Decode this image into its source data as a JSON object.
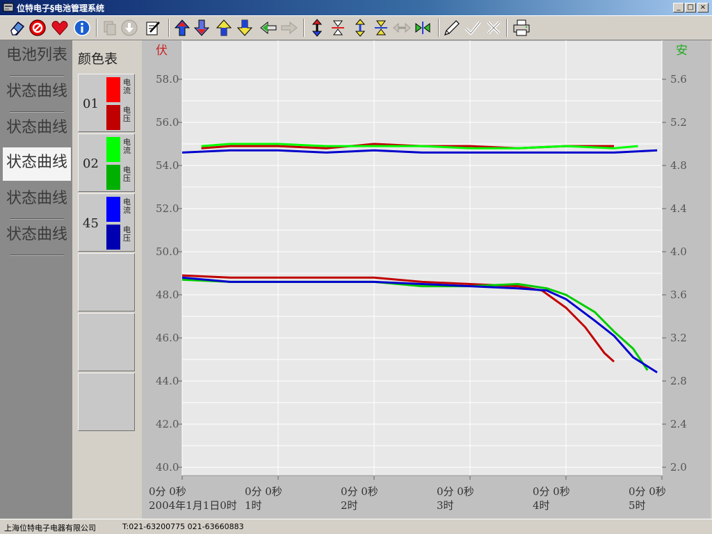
{
  "window": {
    "title": "位特电子§电池管理系统",
    "controls": [
      "_",
      "□",
      "×"
    ]
  },
  "toolbar": {
    "buttons": [
      {
        "icon": "eraser-icon",
        "enabled": true
      },
      {
        "icon": "no-entry-icon",
        "enabled": true
      },
      {
        "icon": "heart-icon",
        "enabled": true
      },
      {
        "icon": "info-icon",
        "enabled": true
      },
      {
        "icon": "copy-icon",
        "enabled": false
      },
      {
        "icon": "download-icon",
        "enabled": false
      },
      {
        "icon": "edit-document-icon",
        "enabled": true
      },
      {
        "icon": "arrow-up-icon",
        "enabled": true
      },
      {
        "icon": "arrow-down-icon",
        "enabled": true
      },
      {
        "icon": "arrow-up-yellow-icon",
        "enabled": true
      },
      {
        "icon": "arrow-down-yellow-icon",
        "enabled": true
      },
      {
        "icon": "arrow-left-icon",
        "enabled": true
      },
      {
        "icon": "arrow-right-icon",
        "enabled": false
      },
      {
        "icon": "expand-vertical-icon",
        "enabled": true
      },
      {
        "icon": "compress-vertical-icon",
        "enabled": true
      },
      {
        "icon": "expand-vertical-yellow-icon",
        "enabled": true
      },
      {
        "icon": "compress-vertical-yellow-icon",
        "enabled": true
      },
      {
        "icon": "expand-horizontal-icon",
        "enabled": false
      },
      {
        "icon": "compress-horizontal-icon",
        "enabled": true
      },
      {
        "icon": "pencil-icon",
        "enabled": true
      },
      {
        "icon": "checkmark-icon",
        "enabled": true
      },
      {
        "icon": "cross-icon",
        "enabled": true
      },
      {
        "icon": "printer-icon",
        "enabled": true
      }
    ]
  },
  "nav": {
    "items": [
      {
        "label": "电池列表",
        "active": false
      },
      {
        "label": "状态曲线",
        "active": false
      },
      {
        "label": "状态曲线",
        "active": false
      },
      {
        "label": "状态曲线",
        "active": true
      },
      {
        "label": "状态曲线",
        "active": false
      },
      {
        "label": "状态曲线",
        "active": false
      }
    ]
  },
  "legend": {
    "heading": "颜色表",
    "groups": [
      {
        "id": "01",
        "current_color": "#ff0000",
        "voltage_color": "#c00000",
        "current_tag": "电流",
        "voltage_tag": "电压"
      },
      {
        "id": "02",
        "current_color": "#00ff00",
        "voltage_color": "#00b000",
        "current_tag": "电流",
        "voltage_tag": "电压"
      },
      {
        "id": "45",
        "current_color": "#0000ff",
        "voltage_color": "#0000b0",
        "current_tag": "电流",
        "voltage_tag": "电压"
      }
    ],
    "empty_slots": 3
  },
  "chart_data": {
    "type": "line",
    "left_axis_unit": "伏",
    "right_axis_unit": "安",
    "left_ylim": [
      40,
      58
    ],
    "right_ylim": [
      2.0,
      5.6
    ],
    "left_ticks": [
      "58.0",
      "56.0",
      "54.0",
      "52.0",
      "50.0",
      "48.0",
      "46.0",
      "44.0",
      "42.0",
      "40.0"
    ],
    "right_ticks": [
      "5.6",
      "5.2",
      "4.8",
      "4.4",
      "4.0",
      "3.6",
      "3.2",
      "2.8",
      "2.4",
      "2.0"
    ],
    "x_ticks": [
      {
        "line1": "0分 0秒",
        "line2": "2004年1月1日0时"
      },
      {
        "line1": "0分 0秒",
        "line2": "1时"
      },
      {
        "line1": "0分 0秒",
        "line2": "2时"
      },
      {
        "line1": "0分 0秒",
        "line2": "3时"
      },
      {
        "line1": "0分 0秒",
        "line2": "4时"
      },
      {
        "line1": "0分 0秒",
        "line2": "5时"
      }
    ],
    "xlim_hours": [
      0,
      5
    ],
    "grid": true,
    "colors": {
      "upper_unit": "#cc2222",
      "right_unit": "#22aa22"
    },
    "series": [
      {
        "color": "#c00000",
        "x": [
          0.2,
          0.5,
          1,
          1.5,
          2,
          2.5,
          3,
          3.5,
          4,
          4.5
        ],
        "y": [
          54.8,
          54.9,
          54.9,
          54.8,
          55.0,
          54.9,
          54.9,
          54.8,
          54.9,
          54.9
        ]
      },
      {
        "color": "#00ff00",
        "x": [
          0.2,
          0.5,
          1,
          1.5,
          2,
          2.5,
          3,
          3.5,
          4,
          4.5,
          4.75
        ],
        "y": [
          54.9,
          55.0,
          55.0,
          54.9,
          54.9,
          54.9,
          54.8,
          54.8,
          54.9,
          54.8,
          54.9
        ]
      },
      {
        "color": "#0000cc",
        "x": [
          0,
          0.5,
          1,
          1.5,
          2,
          2.5,
          3,
          3.5,
          4,
          4.5,
          4.95
        ],
        "y": [
          54.6,
          54.7,
          54.7,
          54.6,
          54.7,
          54.6,
          54.6,
          54.6,
          54.6,
          54.6,
          54.7
        ]
      },
      {
        "color": "#c00000",
        "x": [
          0,
          0.5,
          1,
          1.5,
          2,
          2.5,
          3,
          3.5,
          3.75,
          4,
          4.2,
          4.4,
          4.5
        ],
        "y": [
          48.9,
          48.8,
          48.8,
          48.8,
          48.8,
          48.6,
          48.5,
          48.4,
          48.2,
          47.4,
          46.5,
          45.3,
          44.9
        ]
      },
      {
        "color": "#00cc00",
        "x": [
          0,
          0.5,
          1,
          1.5,
          2,
          2.5,
          3,
          3.5,
          3.8,
          4,
          4.3,
          4.5,
          4.7,
          4.85
        ],
        "y": [
          48.7,
          48.6,
          48.6,
          48.6,
          48.6,
          48.4,
          48.4,
          48.5,
          48.3,
          48.0,
          47.2,
          46.3,
          45.5,
          44.5
        ]
      },
      {
        "color": "#0000cc",
        "x": [
          0,
          0.5,
          1,
          1.5,
          2,
          2.5,
          3,
          3.5,
          3.8,
          4,
          4.3,
          4.5,
          4.7,
          4.95
        ],
        "y": [
          48.8,
          48.6,
          48.6,
          48.6,
          48.6,
          48.5,
          48.4,
          48.3,
          48.2,
          47.8,
          46.8,
          46.1,
          45.1,
          44.4
        ]
      }
    ]
  },
  "status": {
    "company": "上海位特电子电器有限公司",
    "phone": "T:021-63200775 021-63660883"
  }
}
